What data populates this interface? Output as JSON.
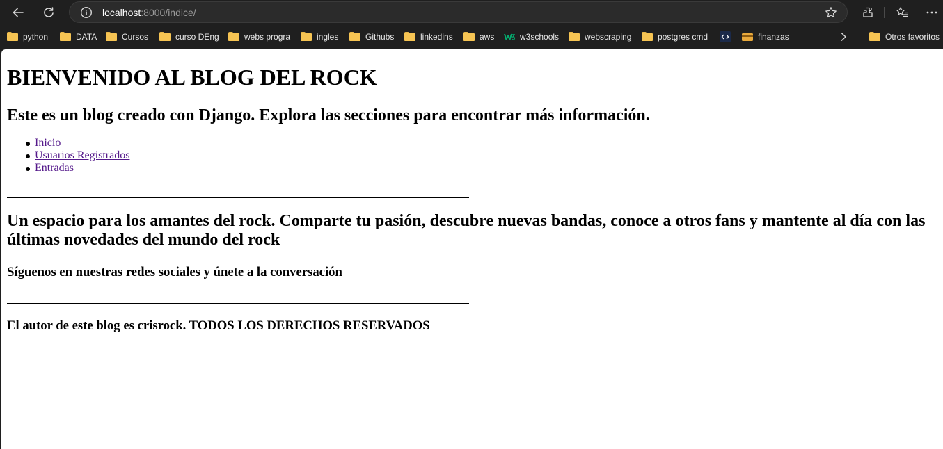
{
  "browser": {
    "url_host": "localhost",
    "url_path": ":8000/indice/",
    "bookmarks": [
      {
        "label": "python",
        "icon": "folder-icon"
      },
      {
        "label": "DATA",
        "icon": "folder-icon"
      },
      {
        "label": "Cursos",
        "icon": "folder-icon"
      },
      {
        "label": "curso DEng",
        "icon": "folder-icon"
      },
      {
        "label": "webs progra",
        "icon": "folder-icon"
      },
      {
        "label": "ingles",
        "icon": "folder-icon"
      },
      {
        "label": "Githubs",
        "icon": "folder-icon"
      },
      {
        "label": "linkedins",
        "icon": "folder-icon"
      },
      {
        "label": "aws",
        "icon": "folder-icon"
      },
      {
        "label": "w3schools",
        "icon": "w3schools-icon"
      },
      {
        "label": "webscraping",
        "icon": "folder-icon"
      },
      {
        "label": "postgres cmd",
        "icon": "folder-icon"
      },
      {
        "label": "",
        "icon": "code-icon"
      },
      {
        "label": "finanzas",
        "icon": "card-icon"
      }
    ],
    "other_favorites": "Otros favoritos"
  },
  "page": {
    "title": "BIENVENIDO AL BLOG DEL ROCK",
    "subtitle": "Este es un blog creado con Django. Explora las secciones para encontrar más información.",
    "nav": [
      "Inicio",
      "Usuarios Registrados",
      "Entradas"
    ],
    "intro": "Un espacio para los amantes del rock. Comparte tu pasión, descubre nuevas bandas, conoce a otros fans y mantente al día con las últimas novedades del mundo del rock",
    "social": "Síguenos en nuestras redes sociales y únete a la conversación",
    "footer": "El autor de este blog es crisrock. TODOS LOS DERECHOS RESERVADOS"
  },
  "colors": {
    "chrome_bg": "#1f1f1f",
    "address_bg": "#2b2b2b",
    "folder": "#f6c453",
    "visited_link": "#551a8b"
  }
}
